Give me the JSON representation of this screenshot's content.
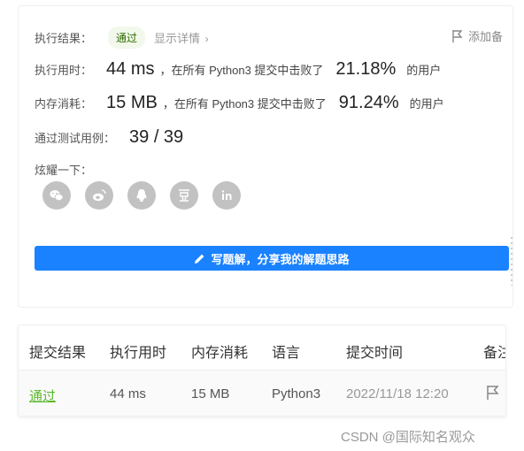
{
  "result": {
    "label": "执行结果：",
    "status": "通过",
    "detail_link": "显示详情",
    "flag_label": "添加备"
  },
  "runtime": {
    "label": "执行用时：",
    "value": "44 ms",
    "prefix": "，在所有 Python3 提交中击败了",
    "percent": "21.18%",
    "suffix": "的用户"
  },
  "memory": {
    "label": "内存消耗：",
    "value": "15 MB",
    "prefix": "，在所有 Python3 提交中击败了",
    "percent": "91.24%",
    "suffix": "的用户"
  },
  "tests": {
    "label": "通过测试用例：",
    "value": "39 / 39"
  },
  "share": {
    "label": "炫耀一下：",
    "icons": [
      "wechat-icon",
      "weibo-icon",
      "qq-icon",
      "douban-icon",
      "linkedin-icon"
    ]
  },
  "cta": {
    "label": "写题解，分享我的解题思路"
  },
  "table": {
    "headers": [
      "提交结果",
      "执行用时",
      "内存消耗",
      "语言",
      "提交时间",
      "备注"
    ],
    "row": {
      "result": "通过",
      "runtime": "44 ms",
      "memory": "15 MB",
      "language": "Python3",
      "time": "2022/11/18 12:20"
    }
  },
  "watermark": "CSDN @国际知名观众",
  "colors": {
    "accent_blue": "#1a82ff",
    "pass_green": "#5ab726",
    "badge_bg": "#f2f9ec",
    "icon_gray": "#c2c2c2"
  }
}
